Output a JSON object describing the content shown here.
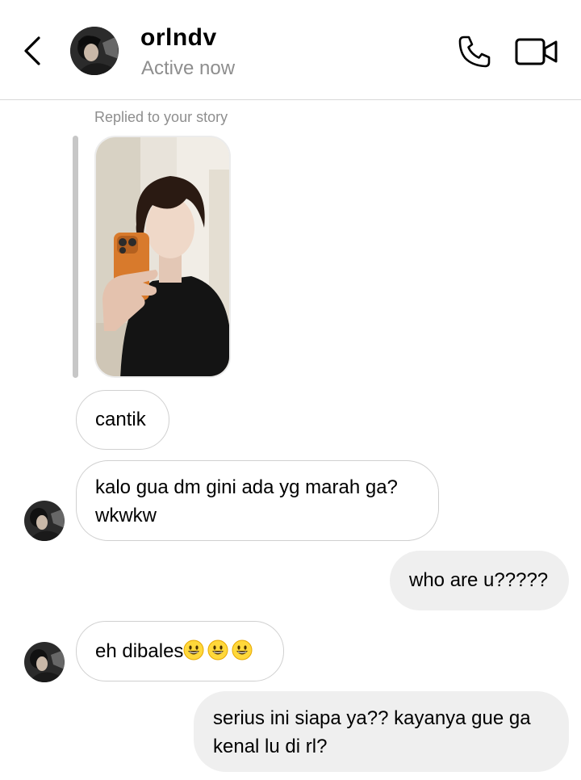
{
  "header": {
    "username": "orlndv",
    "status": "Active now",
    "back_icon": "chevron-left-icon",
    "call_icon": "phone-icon",
    "video_icon": "video-camera-icon"
  },
  "story_reply": {
    "label": "Replied to your story"
  },
  "messages": [
    {
      "direction": "incoming",
      "text": "cantik"
    },
    {
      "direction": "incoming",
      "lines": [
        "kalo gua dm gini ada yg marah ga?",
        "wkwkw"
      ]
    },
    {
      "direction": "outgoing",
      "text": "who are u?????"
    },
    {
      "direction": "incoming",
      "text": "eh dibales",
      "emoji": [
        "😃",
        "😃",
        "😃"
      ]
    },
    {
      "direction": "outgoing",
      "lines": [
        "serius ini siapa ya?? kayanya gue ga",
        "kenal lu di rl?"
      ]
    }
  ],
  "colors": {
    "incoming_border": "#d0d0d0",
    "outgoing_bg": "#efefef",
    "muted_text": "#8e8e8e"
  }
}
